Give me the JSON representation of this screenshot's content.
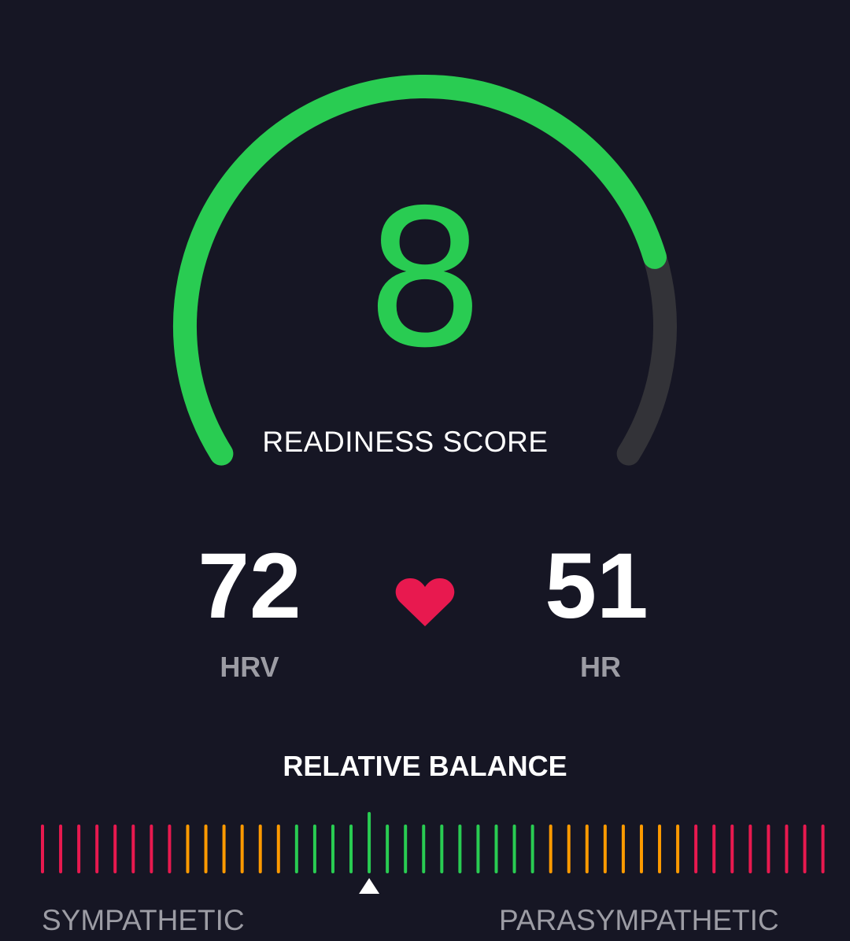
{
  "readiness": {
    "score": "8",
    "label": "READINESS SCORE",
    "gauge_fraction": 0.8,
    "colors": {
      "fill": "#29cc52",
      "track": "#333338"
    }
  },
  "metrics": {
    "hrv": {
      "value": "72",
      "label": "HRV"
    },
    "hr": {
      "value": "51",
      "label": "HR"
    },
    "heart_icon": "heart-icon",
    "heart_color": "#e8194f"
  },
  "balance": {
    "title": "RELATIVE BALANCE",
    "left_label": "SYMPATHETIC",
    "right_label": "PARASYMPATHETIC",
    "tick_colors": [
      "#e8194f",
      "#e8194f",
      "#e8194f",
      "#e8194f",
      "#e8194f",
      "#e8194f",
      "#e8194f",
      "#e8194f",
      "#ff9a00",
      "#ff9a00",
      "#ff9a00",
      "#ff9a00",
      "#ff9a00",
      "#ff9a00",
      "#29cc52",
      "#29cc52",
      "#29cc52",
      "#29cc52",
      "#29cc52",
      "#29cc52",
      "#29cc52",
      "#29cc52",
      "#29cc52",
      "#29cc52",
      "#29cc52",
      "#29cc52",
      "#29cc52",
      "#29cc52",
      "#ff9a00",
      "#ff9a00",
      "#ff9a00",
      "#ff9a00",
      "#ff9a00",
      "#ff9a00",
      "#ff9a00",
      "#ff9a00",
      "#e8194f",
      "#e8194f",
      "#e8194f",
      "#e8194f",
      "#e8194f",
      "#e8194f",
      "#e8194f",
      "#e8194f"
    ],
    "selected_index": 18
  }
}
